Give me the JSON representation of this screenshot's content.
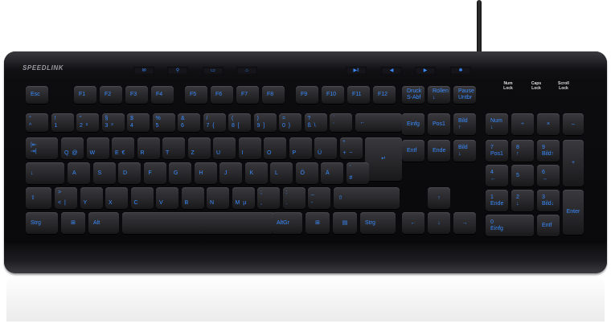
{
  "brand": "SPEEDLINK",
  "led_labels": [
    {
      "name": "num-lock-label",
      "text": "Num\nLock"
    },
    {
      "name": "caps-lock-label",
      "text": "Caps\nLock"
    },
    {
      "name": "scroll-lock-label",
      "text": "Scroll\nLock"
    }
  ],
  "media_keys": [
    {
      "name": "mail-icon",
      "glyph": "✉"
    },
    {
      "name": "search-icon",
      "glyph": "⚲"
    },
    {
      "name": "mycomputer-icon",
      "glyph": "▭"
    },
    {
      "name": "home-icon",
      "glyph": "⌂"
    },
    {
      "name": "play-pause-icon",
      "glyph": "▶‖"
    },
    {
      "name": "volume-down-icon",
      "glyph": "◀"
    },
    {
      "name": "volume-up-icon",
      "glyph": "▶"
    },
    {
      "name": "mute-icon",
      "glyph": "✱"
    }
  ],
  "keys": {
    "esc": "Esc",
    "f": [
      "F1",
      "F2",
      "F3",
      "F4",
      "F5",
      "F6",
      "F7",
      "F8",
      "F9",
      "F10",
      "F11",
      "F12"
    ],
    "druck": "Druck\nS-Abf",
    "rollen": "Rollen\n↓",
    "pause": "Pause\nUntbr",
    "row1": [
      [
        "°",
        "^"
      ],
      [
        "!",
        "1"
      ],
      [
        "\"",
        "2  ²"
      ],
      [
        "§",
        "3  ³"
      ],
      [
        "$",
        "4"
      ],
      [
        "%",
        "5"
      ],
      [
        "&",
        "6"
      ],
      [
        "/",
        "7  {"
      ],
      [
        "(",
        "8  ["
      ],
      [
        ")",
        "9  ]"
      ],
      [
        "=",
        "0  }"
      ],
      [
        "?",
        "ß  \\"
      ],
      [
        "`",
        "´"
      ]
    ],
    "backspace": "←",
    "tab": "|⇤\n⇥|",
    "row2": [
      [
        "",
        "Q  @"
      ],
      [
        "",
        "W"
      ],
      [
        "",
        "E  €"
      ],
      [
        "",
        "R"
      ],
      [
        "",
        "T"
      ],
      [
        "",
        "Z"
      ],
      [
        "",
        "U"
      ],
      [
        "",
        "I"
      ],
      [
        "",
        "O"
      ],
      [
        "",
        "P"
      ],
      [
        "",
        "Ü"
      ],
      [
        "*",
        "+  ~"
      ]
    ],
    "enter": "↵",
    "caps": "↓",
    "row3": [
      "A",
      "S",
      "D",
      "F",
      "G",
      "H",
      "J",
      "K",
      "L",
      "Ö",
      "Ä"
    ],
    "hash": [
      "'",
      "#"
    ],
    "lshift": "⇧",
    "row4": [
      [
        ">",
        "<  |"
      ],
      [
        "",
        "Y"
      ],
      [
        "",
        "X"
      ],
      [
        "",
        "C"
      ],
      [
        "",
        "V"
      ],
      [
        "",
        "B"
      ],
      [
        "",
        "N"
      ],
      [
        "",
        "M  µ"
      ],
      [
        ";",
        ","
      ],
      [
        ":",
        "."
      ],
      [
        "_",
        "-"
      ]
    ],
    "rshift": "⇧",
    "strg": "Strg",
    "win": "⊞",
    "alt": "Alt",
    "altgr": "AltGr",
    "menu": "▤",
    "einfg": "Einfg",
    "pos1": "Pos1",
    "bildup": "Bild\n↑",
    "entf": "Entf",
    "ende": "Ende",
    "bilddown": "Bild\n↓",
    "arrows": {
      "up": "↑",
      "left": "←",
      "down": "↓",
      "right": "→"
    },
    "numpad": {
      "num": "Num\n↓",
      "div": "÷",
      "mul": "×",
      "minus": "–",
      "n7": "7\nPos1",
      "n8": "8\n↑",
      "n9": "9\nBild↑",
      "plus": "+",
      "n4": "4\n←",
      "n5": "5",
      "n6": "6\n→",
      "n1": "1\nEnde",
      "n2": "2\n↓",
      "n3": "3\nBild↓",
      "enter": "Enter",
      "n0": "0\nEinfg",
      "dot": "Entf"
    }
  }
}
